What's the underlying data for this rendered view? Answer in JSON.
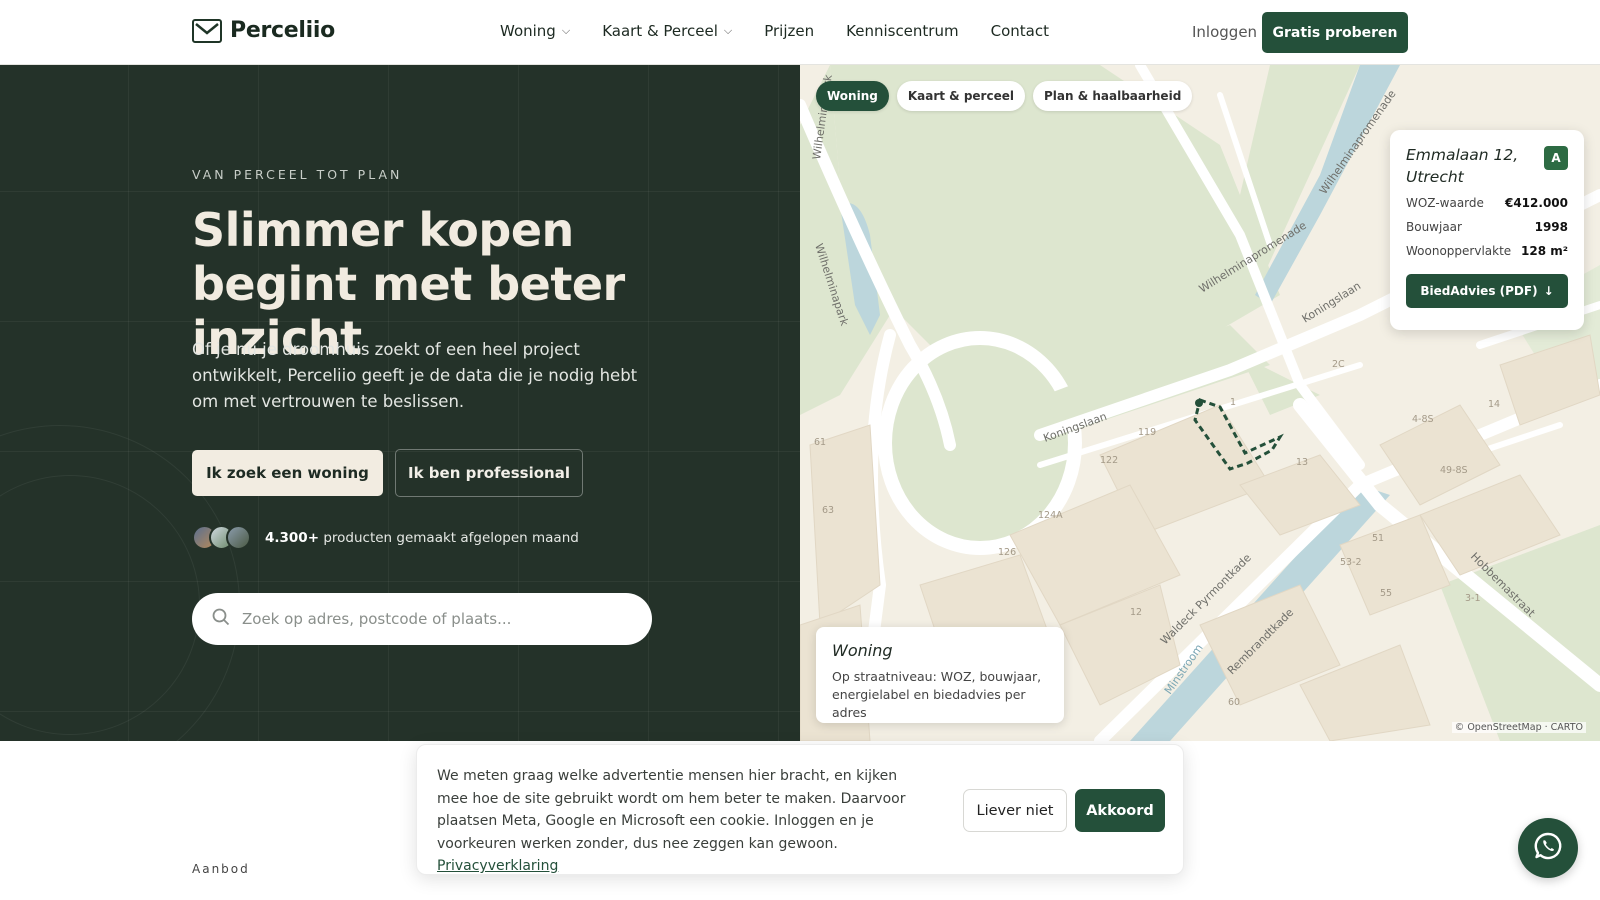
{
  "nav": {
    "brand": "Perceliio",
    "links": [
      {
        "label": "Woning",
        "has_dropdown": true
      },
      {
        "label": "Kaart & Perceel",
        "has_dropdown": true
      },
      {
        "label": "Prijzen",
        "has_dropdown": false
      },
      {
        "label": "Kenniscentrum",
        "has_dropdown": false
      },
      {
        "label": "Contact",
        "has_dropdown": false
      }
    ],
    "login": "Inloggen",
    "cta": "Gratis proberen"
  },
  "hero": {
    "eyebrow": "VAN PERCEEL TOT PLAN",
    "title": "Slimmer kopen begint met beter inzicht",
    "subtitle": "Of je nu je droomhuis zoekt of een heel project ontwikkelt, Perceliio geeft je de data die je nodig hebt om met vertrouwen te beslissen.",
    "primary_button": "Ik zoek een woning",
    "secondary_button": "Ik ben professional",
    "proof_count": "4.300+",
    "proof_text": "producten gemaakt afgelopen maand",
    "search_placeholder": "Zoek op adres, postcode of plaats..."
  },
  "map": {
    "chips": [
      {
        "label": "Woning",
        "active": true
      },
      {
        "label": "Kaart & perceel",
        "active": false
      },
      {
        "label": "Plan & haalbaarheid",
        "active": false
      }
    ],
    "property": {
      "address": "Emmalaan 12, Utrecht",
      "energy_label": "A",
      "rows": [
        {
          "label": "WOZ-waarde",
          "value": "€412.000"
        },
        {
          "label": "Bouwjaar",
          "value": "1998"
        },
        {
          "label": "Woonoppervlakte",
          "value": "128 m²"
        }
      ],
      "button": "BiedAdvies (PDF)",
      "button_icon": "↓"
    },
    "layer": {
      "title": "Woning",
      "description": "Op straatniveau: WOZ, bouwjaar, energielabel en biedadvies per adres"
    },
    "street_labels": [
      "Wilhelminapark",
      "Wilhelminapark",
      "Wilhelminapromenade",
      "Wilhelminapromenade",
      "Koningslaan",
      "Koningslaan",
      "Waldeck Pyrmontkade",
      "Rembrandtkade",
      "Hobbemastraat",
      "Minstroom"
    ],
    "house_numbers": [
      "119",
      "122",
      "124A",
      "126",
      "61",
      "63",
      "12",
      "60",
      "51",
      "53-2",
      "55",
      "3-1",
      "49-8S",
      "4-8S",
      "2C",
      "1",
      "13",
      "14"
    ],
    "attribution": "© OpenStreetMap · CARTO"
  },
  "below": {
    "section_label": "Aanbod"
  },
  "cookie": {
    "text": "We meten graag welke advertentie mensen hier bracht, en kijken mee hoe de site gebruikt wordt om hem beter te maken. Daarvoor plaatsen Meta, Google en Microsoft een cookie. Inloggen en je voorkeuren werken zonder, dus nee zeggen kan gewoon.",
    "link": "Privacyverklaring",
    "decline": "Liever niet",
    "accept": "Akkoord"
  },
  "colors": {
    "brand_green": "#24503a",
    "hero_bg": "#243229",
    "cream": "#f2ece1",
    "map_bg": "#f3efe4",
    "park_green": "#dde6cf",
    "water": "#bcd6dc"
  },
  "icons": {
    "logo": "envelope-icon",
    "search": "search-icon",
    "whatsapp": "whatsapp-icon",
    "chevron": "chevron-down-icon"
  }
}
